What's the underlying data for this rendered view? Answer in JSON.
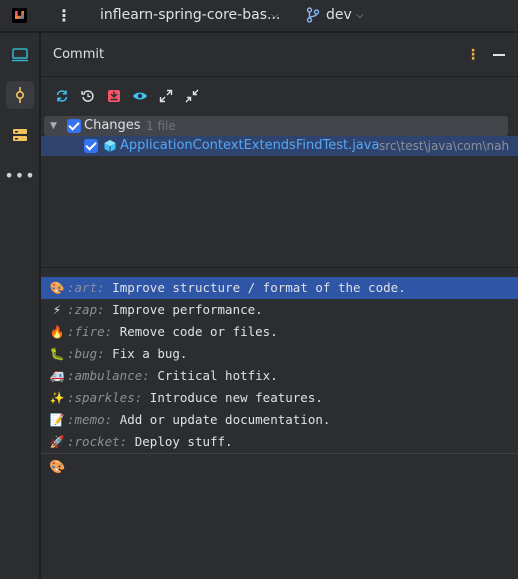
{
  "titlebar": {
    "project_name": "inflearn-spring-core-bas...",
    "branch_name": "dev"
  },
  "toolstrip": {
    "items": [
      "project-icon",
      "commit-icon",
      "structure-icon",
      "more-icon"
    ],
    "more_glyph": "•••"
  },
  "commit_panel": {
    "title": "Commit",
    "options_glyph": "⋮",
    "toolbar": [
      "refresh-icon",
      "rollback-icon",
      "shelve-icon",
      "show-diff-icon",
      "expand-all-icon",
      "collapse-all-icon"
    ],
    "tree": {
      "group_label": "Changes",
      "group_count": "1 file",
      "file_name": "ApplicationContextExtendsFindTest.java",
      "file_path": "src\\test\\java\\com\\nah"
    },
    "gitmoji_list": [
      {
        "glyph": "🎨",
        "code": ":art:",
        "description": "Improve structure / format of the code.",
        "selected": true
      },
      {
        "glyph": "⚡",
        "code": ":zap:",
        "description": "Improve performance.",
        "selected": false
      },
      {
        "glyph": "🔥",
        "code": ":fire:",
        "description": "Remove code or files.",
        "selected": false
      },
      {
        "glyph": "🐛",
        "code": ":bug:",
        "description": "Fix a bug.",
        "selected": false
      },
      {
        "glyph": "🚑",
        "code": ":ambulance:",
        "description": "Critical hotfix.",
        "selected": false
      },
      {
        "glyph": "✨",
        "code": ":sparkles:",
        "description": "Introduce new features.",
        "selected": false
      },
      {
        "glyph": "📝",
        "code": ":memo:",
        "description": "Add or update documentation.",
        "selected": false
      },
      {
        "glyph": "🚀",
        "code": ":rocket:",
        "description": "Deploy stuff.",
        "selected": false
      }
    ],
    "message_emoji": "🎨"
  },
  "colors": {
    "background": "#2b2d30",
    "selection": "#2e55a6",
    "file_link": "#56a8f5",
    "checkbox": "#3574f0"
  }
}
